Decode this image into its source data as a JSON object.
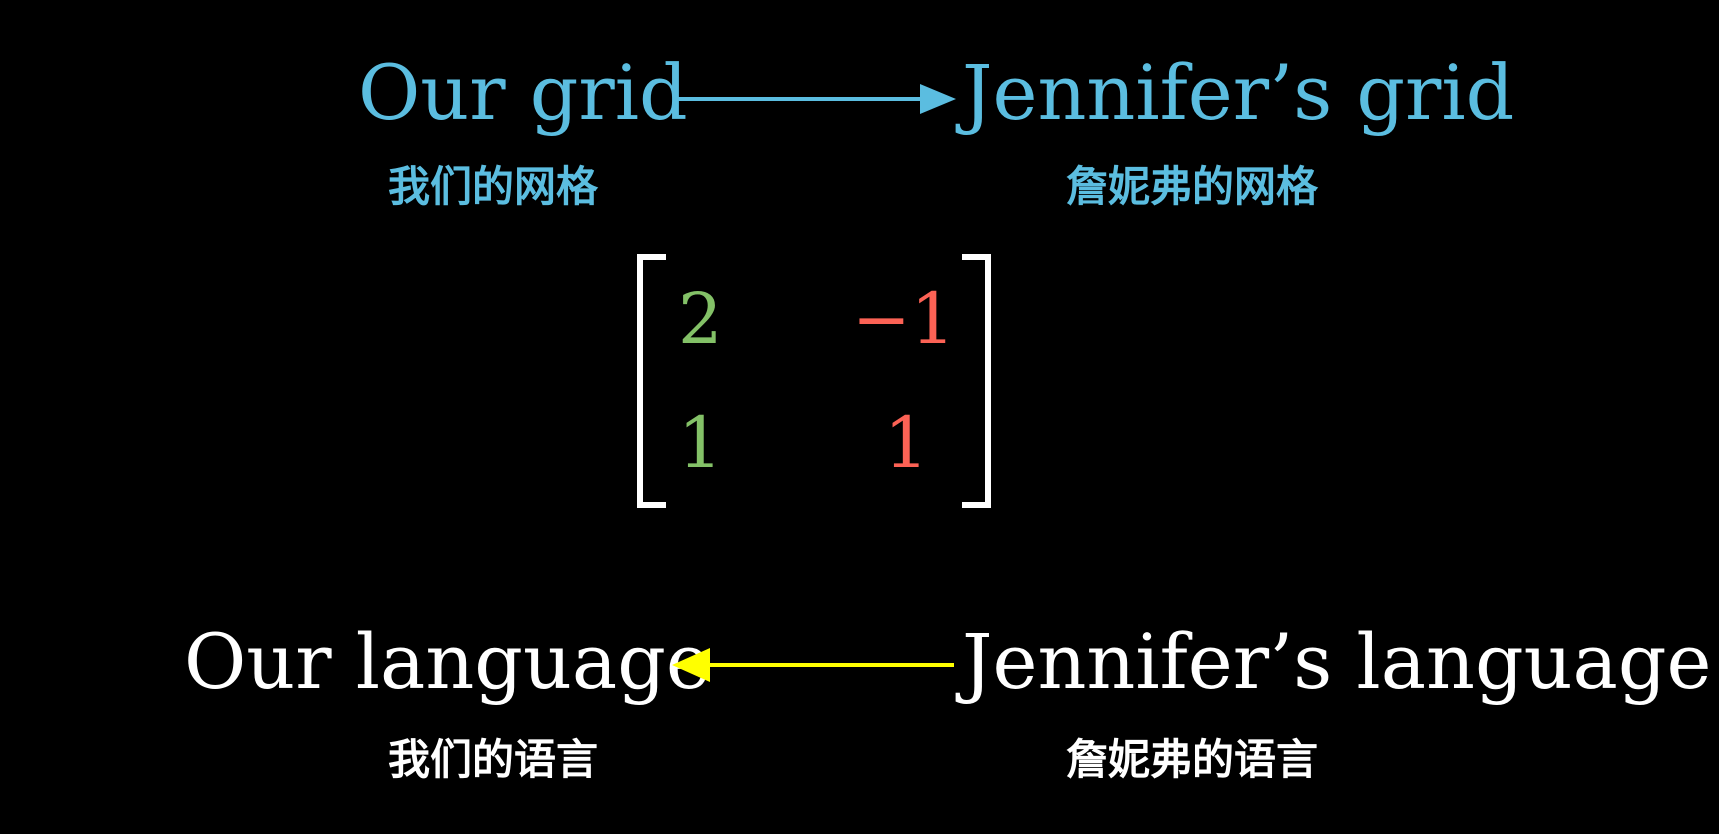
{
  "top": {
    "left_label": "Our grid",
    "right_label": "Jennifer’s grid",
    "left_caption": "我们的网格",
    "right_caption": "詹妮弗的网格",
    "arrow_direction": "right",
    "color": "#5bbde0"
  },
  "matrix": {
    "rows": [
      [
        "2",
        "−1"
      ],
      [
        "1",
        "1"
      ]
    ],
    "column_colors": [
      "#83c167",
      "#fc6255"
    ],
    "bracket_color": "#ffffff"
  },
  "bottom": {
    "left_label": "Our language",
    "right_label": "Jennifer’s language",
    "left_caption": "我们的语言",
    "right_caption": "詹妮弗的语言",
    "arrow_direction": "left",
    "arrow_color": "#ffff00",
    "text_color": "#ffffff"
  },
  "background": "#000000"
}
